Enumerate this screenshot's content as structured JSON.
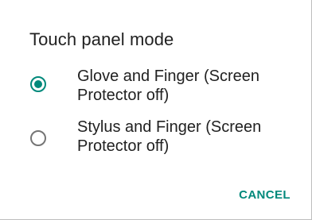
{
  "dialog": {
    "title": "Touch panel mode",
    "options": [
      {
        "label": "Glove and Finger (Screen Protector off)",
        "selected": true
      },
      {
        "label": "Stylus and Finger (Screen Protector off)",
        "selected": false
      }
    ],
    "cancel_label": "CANCEL"
  },
  "colors": {
    "accent": "#00897b",
    "text": "#212121",
    "radio_off": "#757575"
  },
  "icons": {
    "selected": "radio-checked-icon",
    "unselected": "radio-unchecked-icon"
  }
}
